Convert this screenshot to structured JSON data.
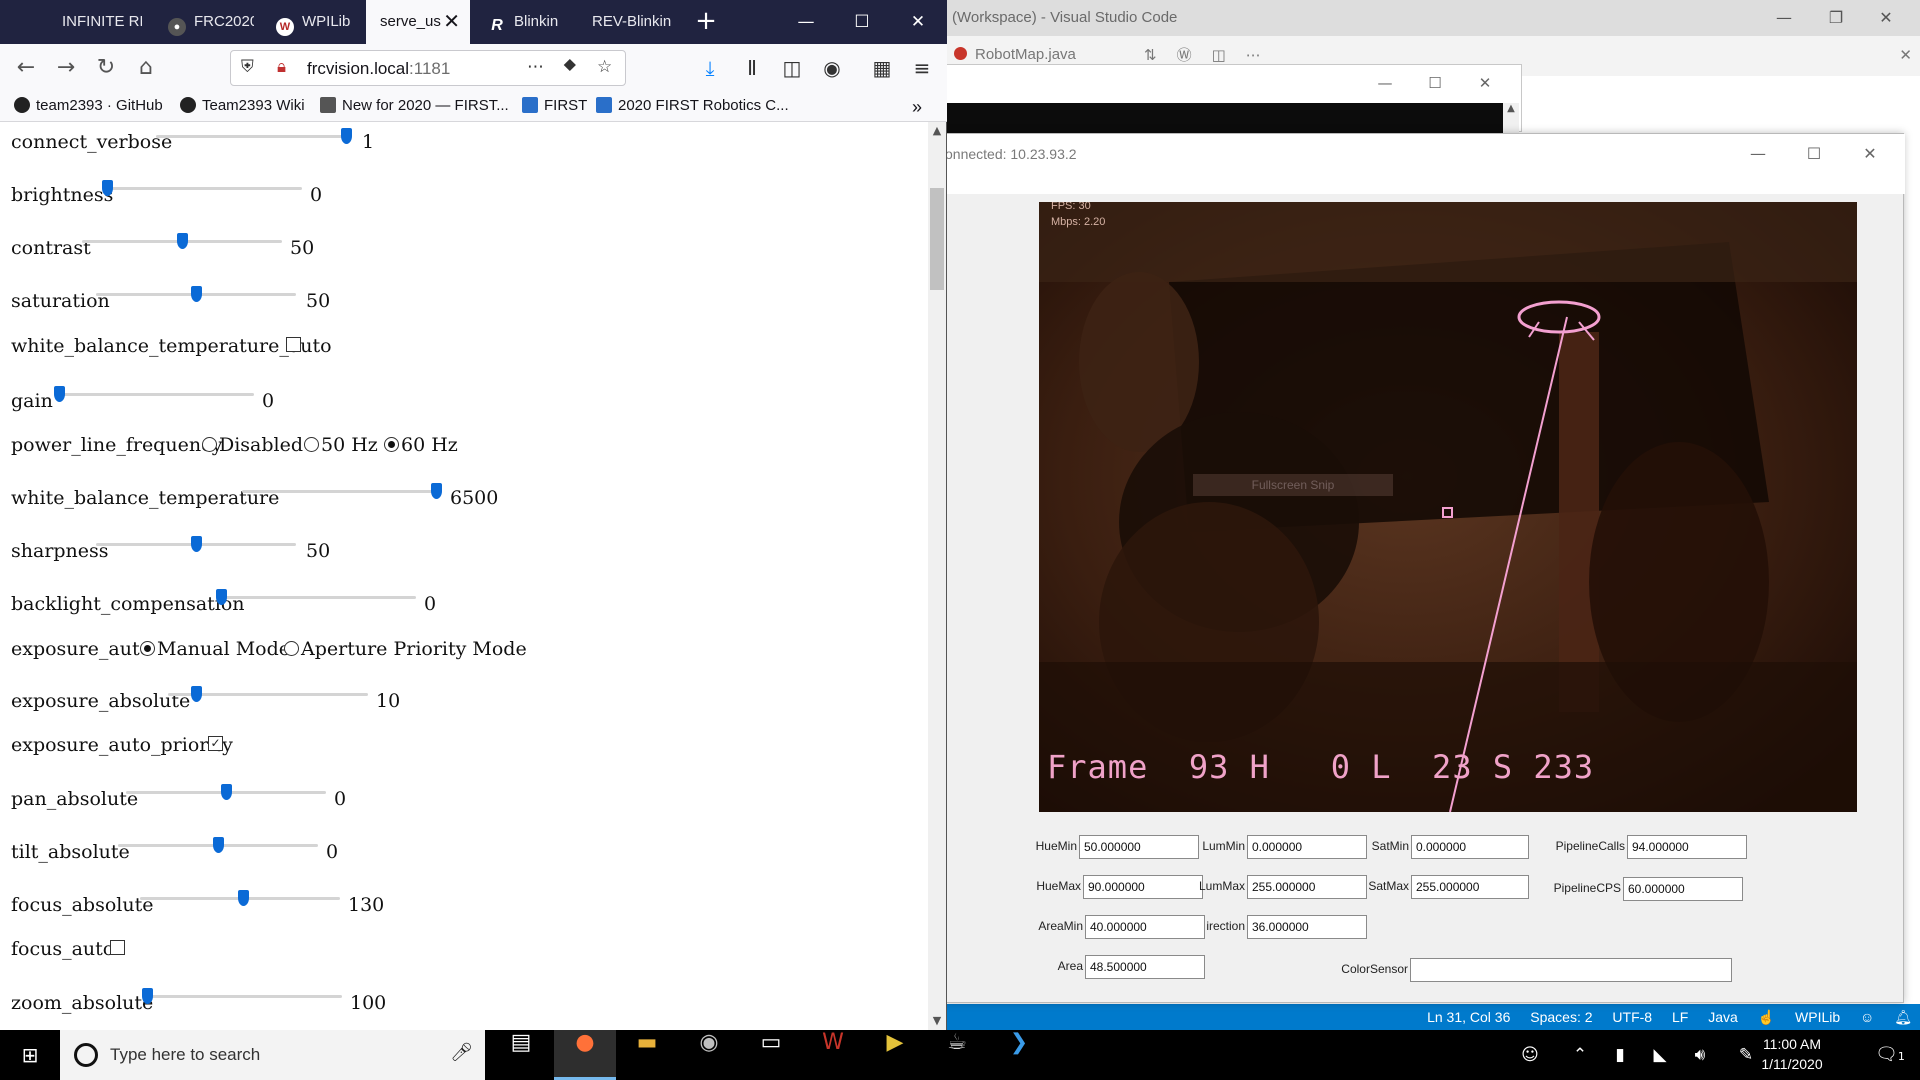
{
  "vscode": {
    "title": "(Workspace) - Visual Studio Code",
    "editor_tab": "RobotMap.java",
    "status": [
      "Ln 31, Col 36",
      "Spaces: 2",
      "UTF-8",
      "LF",
      "Java",
      "WPILib"
    ]
  },
  "vision": {
    "connection": "onnected: 10.23.93.2",
    "overlay": {
      "fps": "FPS: 30",
      "mbps": "Mbps: 2.20",
      "frame_line": "Frame  93 H   0 L  23 S 233",
      "snip_label": "Fullscreen Snip"
    },
    "fields": {
      "huemin": {
        "label": "HueMin",
        "value": "50.000000"
      },
      "lummin": {
        "label": "LumMin",
        "value": "0.000000"
      },
      "satmin": {
        "label": "SatMin",
        "value": "0.000000"
      },
      "pipelinecalls": {
        "label": "PipelineCalls",
        "value": "94.000000"
      },
      "huemax": {
        "label": "HueMax",
        "value": "90.000000"
      },
      "lummax": {
        "label": "LumMax",
        "value": "255.000000"
      },
      "satmax": {
        "label": "SatMax",
        "value": "255.000000"
      },
      "pipelinecps": {
        "label": "PipelineCPS",
        "value": "60.000000"
      },
      "areamin": {
        "label": "AreaMin",
        "value": "40.000000"
      },
      "direction": {
        "label": "irection",
        "value": "36.000000"
      },
      "area": {
        "label": "Area",
        "value": "48.500000"
      },
      "colorsensor": {
        "label": "ColorSensor",
        "value": ""
      }
    }
  },
  "firefox": {
    "tabs": [
      {
        "label": "INFINITE RE",
        "icon": "infinite-recharge-icon"
      },
      {
        "label": "FRC2020",
        "icon": "github-icon"
      },
      {
        "label": "WPILib",
        "icon": "wpilib-icon"
      },
      {
        "label": "serve_us",
        "icon": "none"
      },
      {
        "label": "Blinkin",
        "icon": "rev-icon"
      },
      {
        "label": "REV-Blinkin",
        "icon": "none"
      }
    ],
    "url": {
      "host": "frcvision.local",
      "port": ":1181"
    },
    "bookmarks": [
      "team2393 · GitHub",
      "Team2393 Wiki",
      "New for 2020 — FIRST...",
      "FIRST",
      "2020 FIRST Robotics C..."
    ],
    "accent": "#0b6ad6",
    "controls": {
      "connect_verbose": {
        "label": "connect_verbose",
        "value": "1",
        "level": 1.0
      },
      "brightness": {
        "label": "brightness",
        "value": "0",
        "level": 0.0
      },
      "contrast": {
        "label": "contrast",
        "value": "50",
        "level": 0.5
      },
      "saturation": {
        "label": "saturation",
        "value": "50",
        "level": 0.5
      },
      "wbt_auto": {
        "label": "white_balance_temperature_auto",
        "checked": false
      },
      "gain": {
        "label": "gain",
        "value": "0",
        "level": 0.0
      },
      "power_line_frequency": {
        "label": "power_line_frequency",
        "options": [
          "Disabled",
          "50 Hz",
          "60 Hz"
        ],
        "selected": "60 Hz"
      },
      "wbt": {
        "label": "white_balance_temperature",
        "value": "6500",
        "level": 1.0
      },
      "sharpness": {
        "label": "sharpness",
        "value": "50",
        "level": 0.5
      },
      "backlight": {
        "label": "backlight_compensation",
        "value": "0",
        "level": 0.0
      },
      "exposure_auto": {
        "label": "exposure_auto",
        "options": [
          "Manual Mode",
          "Aperture Priority Mode"
        ],
        "selected": "Manual Mode"
      },
      "exposure_absolute": {
        "label": "exposure_absolute",
        "value": "10",
        "level": 0.12
      },
      "exposure_auto_priority": {
        "label": "exposure_auto_priority",
        "checked": true
      },
      "pan_absolute": {
        "label": "pan_absolute",
        "value": "0",
        "level": 0.5
      },
      "tilt_absolute": {
        "label": "tilt_absolute",
        "value": "0",
        "level": 0.5
      },
      "focus_absolute": {
        "label": "focus_absolute",
        "value": "130",
        "level": 0.52
      },
      "focus_auto": {
        "label": "focus_auto",
        "checked": false
      },
      "zoom_absolute": {
        "label": "zoom_absolute",
        "value": "100",
        "level": 0.0
      }
    }
  },
  "taskbar": {
    "search_placeholder": "Type here to search",
    "time": "11:00 AM",
    "date": "1/11/2020",
    "notifications": "1"
  }
}
